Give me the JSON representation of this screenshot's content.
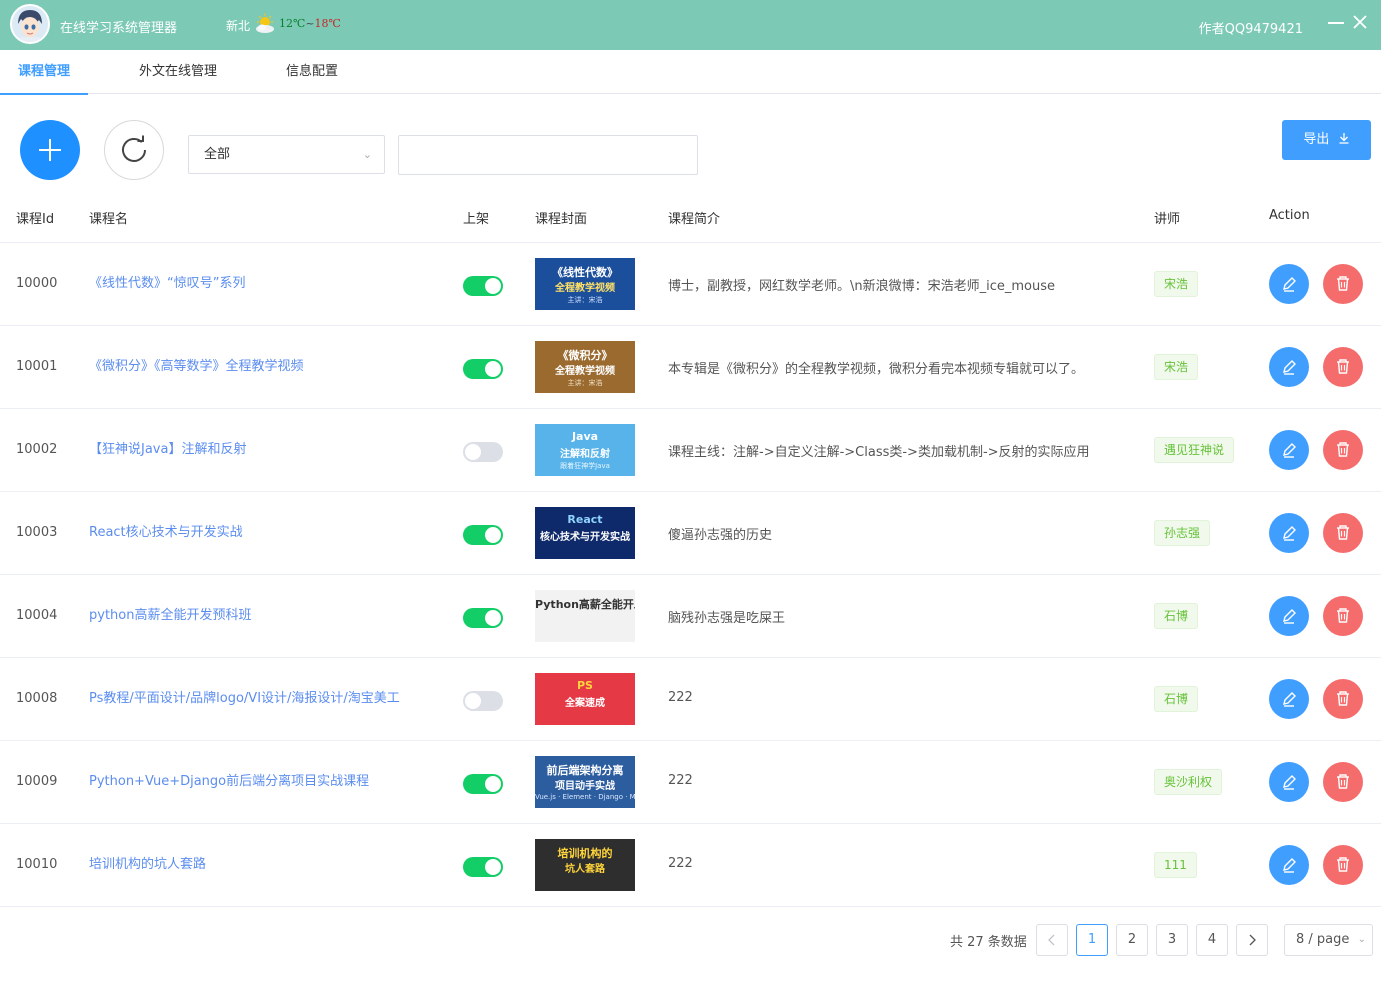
{
  "titlebar": {
    "app_title": "在线学习系统管理器",
    "city": "新北",
    "temp_low": "12℃",
    "temp_sep": "~",
    "temp_high": "18℃",
    "author": "作者QQ9479421"
  },
  "tabs": [
    {
      "label": "课程管理",
      "active": true
    },
    {
      "label": "外文在线管理",
      "active": false
    },
    {
      "label": "信息配置",
      "active": false
    }
  ],
  "toolbar": {
    "filter_value": "全部",
    "search_value": "",
    "export_label": "导出"
  },
  "table": {
    "headers": {
      "id": "课程Id",
      "name": "课程名",
      "listed": "上架",
      "cover": "课程封面",
      "desc": "课程简介",
      "teacher": "讲师",
      "action": "Action"
    },
    "rows": [
      {
        "id": "10000",
        "name": "《线性代数》“惊叹号”系列",
        "listed": true,
        "desc": "博士，副教授，网红数学老师。\\n新浪微博：宋浩老师_ice_mouse",
        "teacher": "宋浩",
        "cover": {
          "line1": "《线性代数》",
          "line2": "全程教学视频",
          "sub": "主讲：宋浩"
        }
      },
      {
        "id": "10001",
        "name": "《微积分》《高等数学》全程教学视频",
        "listed": true,
        "desc": "本专辑是《微积分》的全程教学视频，微积分看完本视频专辑就可以了。",
        "teacher": "宋浩",
        "cover": {
          "line1": "《微积分》",
          "line2": "全程教学视频",
          "sub": "主讲：宋浩"
        }
      },
      {
        "id": "10002",
        "name": "【狂神说Java】注解和反射",
        "listed": false,
        "desc": "课程主线：注解->自定义注解->Class类->类加载机制->反射的实际应用",
        "teacher": "遇见狂神说",
        "cover": {
          "line1": "Java",
          "line2": "注解和反射",
          "sub": "跟着狂神学Java"
        }
      },
      {
        "id": "10003",
        "name": "React核心技术与开发实战",
        "listed": true,
        "desc": "傻逼孙志强的历史",
        "teacher": "孙志强",
        "cover": {
          "line1": "React",
          "line2": "核心技术与开发实战",
          "sub": ""
        }
      },
      {
        "id": "10004",
        "name": "python高薪全能开发预科班",
        "listed": true,
        "desc": "脑残孙志强是吃屎王",
        "teacher": "石博",
        "cover": {
          "line1": "Python高薪全能开发预科班",
          "line2": "",
          "sub": ""
        }
      },
      {
        "id": "10008",
        "name": "Ps教程/平面设计/品牌logo/VI设计/海报设计/淘宝美工",
        "listed": false,
        "desc": "222",
        "teacher": "石博",
        "cover": {
          "line1": "PS",
          "line2": "全案速成",
          "sub": ""
        }
      },
      {
        "id": "10009",
        "name": "Python+Vue+Django前后端分离项目实战课程",
        "listed": true,
        "desc": "222",
        "teacher": "奥沙利权",
        "cover": {
          "line1": "前后端架构分离",
          "line2": "项目动手实战",
          "sub": "Vue.js · Element · Django · MySQL"
        }
      },
      {
        "id": "10010",
        "name": "培训机构的坑人套路",
        "listed": true,
        "desc": "222",
        "teacher": "111",
        "cover": {
          "line1": "培训机构的",
          "line2": "坑人套路",
          "sub": ""
        }
      }
    ]
  },
  "pager": {
    "total": "共 27 条数据",
    "pages": [
      "1",
      "2",
      "3",
      "4"
    ],
    "current": "1",
    "page_size": "8 / page"
  },
  "colors": {
    "titlebar": "#7ccab5",
    "primary": "#409eff",
    "add_button": "#1e90ff",
    "switch_on": "#13ce66",
    "danger": "#f56c6c",
    "tag_text": "#67c23a"
  },
  "icons": {
    "add": "plus-icon",
    "refresh": "refresh-icon",
    "export": "download-icon",
    "edit": "pencil-icon",
    "delete": "trash-icon",
    "prev": "chevron-left-icon",
    "next": "chevron-right-icon"
  }
}
